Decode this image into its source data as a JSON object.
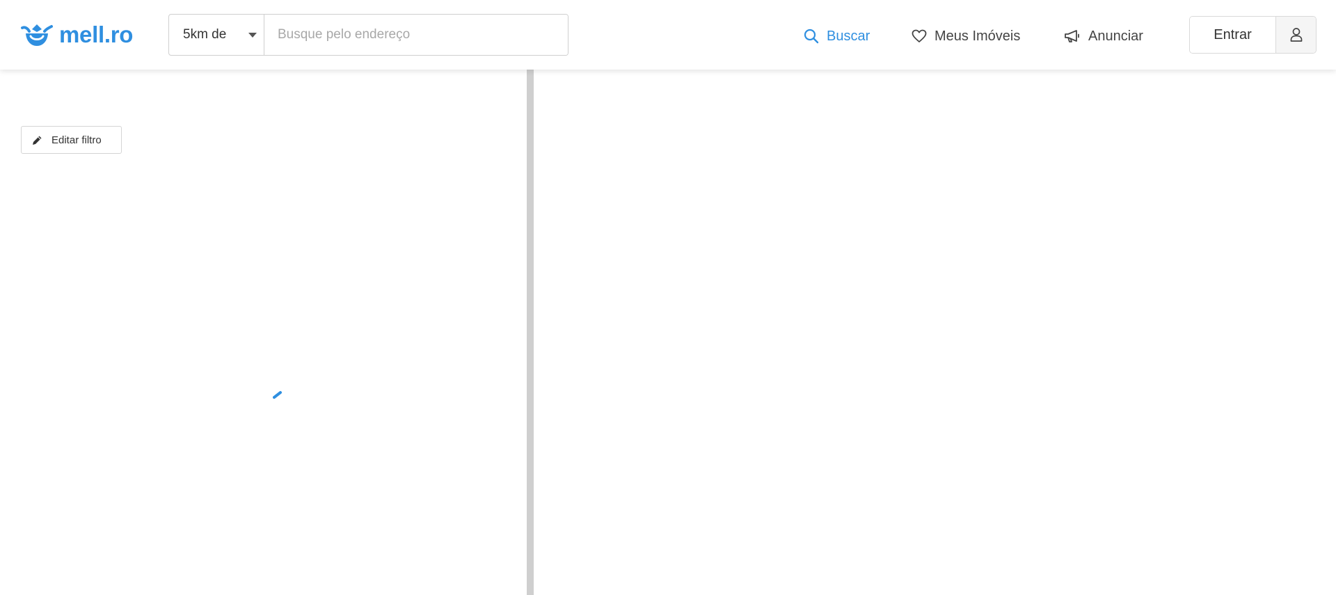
{
  "brand": {
    "name": "mell.ro",
    "color": "#2f8fe0"
  },
  "search": {
    "radius_value": "5km de",
    "placeholder": "Busque pelo endereço",
    "value": ""
  },
  "nav": {
    "search_label": "Buscar",
    "favorites_label": "Meus Imóveis",
    "advertise_label": "Anunciar"
  },
  "account": {
    "login_label": "Entrar"
  },
  "filters": {
    "edit_label": "Editar filtro"
  },
  "icons": {
    "logo": "mellro-logo-icon",
    "search": "search-icon",
    "favorites": "heart-icon",
    "advertise": "megaphone-icon",
    "user": "user-icon",
    "edit": "pencil-icon",
    "loading": "loading-spinner-icon"
  },
  "colors": {
    "accent": "#2f8fe0",
    "divider": "#cfcfcf",
    "text": "#333333"
  }
}
